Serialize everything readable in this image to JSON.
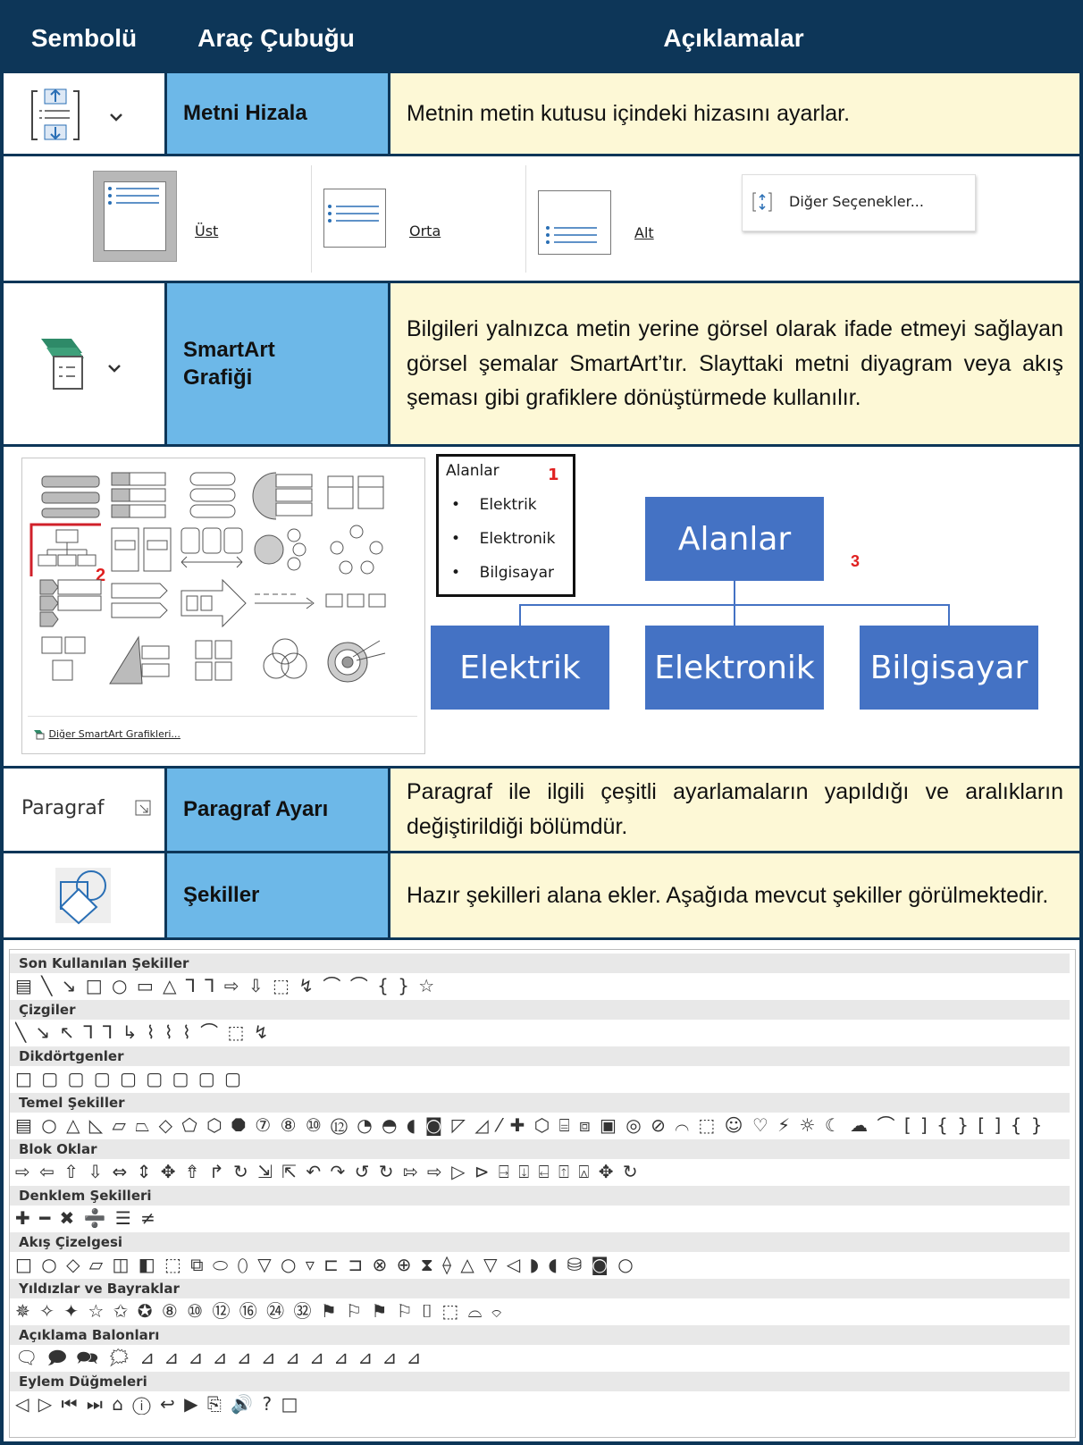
{
  "header": {
    "col1": "Sembolü",
    "col2": "Araç Çubuğu",
    "col3": "Açıklamalar"
  },
  "rows": [
    {
      "name": "Metni Hizala",
      "desc": "Metnin metin kutusu içindeki hizasını ayarlar.",
      "icon": "align-text-icon"
    },
    {
      "name_line1": "SmartArt",
      "name_line2": "Grafiği",
      "desc": "Bilgileri yalnızca metin yerine görsel olarak ifade etmeyi sağlayan görsel şemalar SmartArt’tır. Slayttaki metni diyagram veya akış şeması gibi grafiklere dönüştürmede kullanılır.",
      "icon": "smartart-icon"
    },
    {
      "symbol_text": "Paragraf",
      "name": "Paragraf Ayarı",
      "desc": "Paragraf ile ilgili çeşitli ayarlamaların yapıldığı ve aralıkların değiştirildiği bölümdür.",
      "icon": "dialog-launcher-icon"
    },
    {
      "name": "Şekiller",
      "desc": "Hazır şekilleri alana ekler. Aşağıda mevcut şekiller görülmektedir.",
      "icon": "shapes-icon"
    }
  ],
  "align_options": {
    "top": "Üst",
    "middle": "Orta",
    "bottom": "Alt",
    "more": "Diğer Seçenekler..."
  },
  "smartart_gallery": {
    "more_link": "Diğer SmartArt Grafikleri...",
    "marker": "2"
  },
  "smartart_example": {
    "list_title": "Alanlar",
    "list_items": [
      "Elektrik",
      "Elektronik",
      "Bilgisayar"
    ],
    "marker_list": "1",
    "marker_diagram": "3",
    "root": "Alanlar",
    "children": [
      "Elektrik",
      "Elektronik",
      "Bilgisayar"
    ]
  },
  "shape_categories": [
    {
      "title": "Son Kullanılan Şekiller",
      "glyphs": "▤ ╲ ↘ □ ○ ▭ △ ⅂ ⅂ ⇨ ⇩ ⬚ ↯ ⌒ ⌒ { } ☆"
    },
    {
      "title": "Çizgiler",
      "glyphs": "╲ ↘ ↖ ⅂ ⅂ ↳ ⌇ ⌇ ⌇ ⌒ ⬚ ↯"
    },
    {
      "title": "Dikdörtgenler",
      "glyphs": "□ ▢ ▢ ▢ ▢ ▢ ▢ ▢ ▢"
    },
    {
      "title": "Temel Şekiller",
      "glyphs": "▤ ○ △ ◺ ▱ ⏢ ◇ ⬠ ⬡ ⯃ ⑦ ⑧ ⑩ ⑫ ◔ ◓ ◖ ◙ ◸ ◿ ⁄ ✚ ⬡ ⌸ ⧈ ▣ ◎ ⊘ ⌒ ⬚ ☺ ♡ ⚡ ☼ ☾ ☁ ⌒ [ ] { } [ ] { }"
    },
    {
      "title": "Blok Oklar",
      "glyphs": "⇨ ⇦ ⇧ ⇩ ⇔ ⇕ ✥ ⇮ ↱ ↻ ⇲ ⇱ ↶ ↷ ↺ ↻ ⇰ ⇨ ▷ ⊳ ⍈ ⍗ ⍇ ⍐ ⍓ ✥ ↻"
    },
    {
      "title": "Denklem Şekilleri",
      "glyphs": "✚ ━ ✖ ➗ ☰ ≠"
    },
    {
      "title": "Akış Çizelgesi",
      "glyphs": "□ ○ ◇ ▱ ◫ ◧ ⬚ ⧉ ⬭ ⬯ ▽ ○ ▿ ⊏ ⊐ ⊗ ⊕ ⧗ ⟠ △ ▽ ◁ ◗ ◖ ⛁ ◙ ○"
    },
    {
      "title": "Yıldızlar ve Bayraklar",
      "glyphs": "✵ ✧ ✦ ☆ ✩ ✪ ⑧ ⑩ ⑫ ⑯ ㉔ ㉜ ⚑ ⚐ ⚑ ⚐ ⌷ ⬚ ⌓ ⌔"
    },
    {
      "title": "Açıklama Balonları",
      "glyphs": "🗨 🗩 🗪 🗯 ⊿ ⊿ ⊿ ⊿ ⊿ ⊿ ⊿ ⊿ ⊿ ⊿ ⊿ ⊿"
    },
    {
      "title": "Eylem Düğmeleri",
      "glyphs": "◁ ▷ ⏮ ⏭ ⌂ ⓘ ↩ ▶ ⎘ 🔊 ? □"
    }
  ],
  "colors": {
    "header": "#0d3658",
    "name_cell": "#6db8e8",
    "desc_cell": "#fdf8d6",
    "node": "#4472c4",
    "marker": "#e02020"
  }
}
